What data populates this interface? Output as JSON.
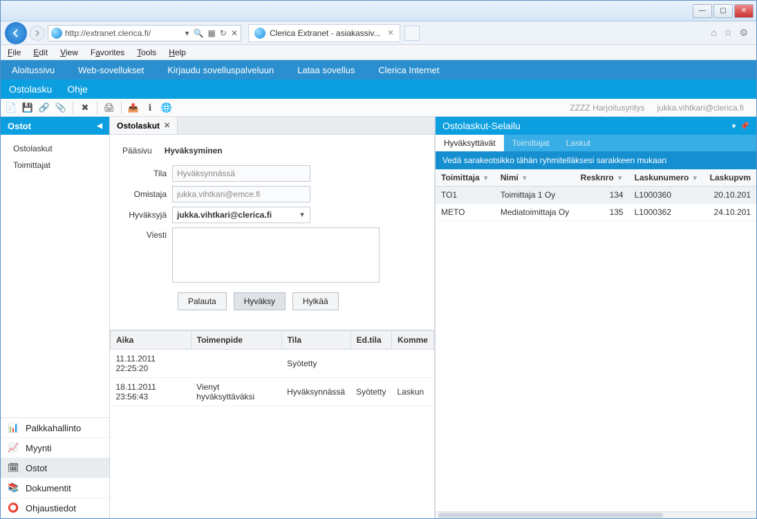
{
  "window": {
    "minimize": "—",
    "maximize": "▢",
    "close": "✕"
  },
  "browser": {
    "url": "http://extranet.clerica.fi/",
    "tab_title": "Clerica Extranet - asiakassiv...",
    "home_icon": "⌂",
    "star_icon": "☆",
    "gear_icon": "⚙"
  },
  "menubar": {
    "file": "File",
    "edit": "Edit",
    "view": "View",
    "favorites": "Favorites",
    "tools": "Tools",
    "help": "Help"
  },
  "appnav1": {
    "aloitussivu": "Aloitussivu",
    "websovellukset": "Web-sovellukset",
    "kirjaudu": "Kirjaudu sovelluspalveluun",
    "lataa": "Lataa sovellus",
    "clerica": "Clerica Internet"
  },
  "appnav2": {
    "ostolasku": "Ostolasku",
    "ohje": "Ohje"
  },
  "userbar": {
    "org": "ZZZZ Harjoitusyritys",
    "email": "jukka.vihtkari@clerica.fi"
  },
  "sidebar": {
    "head": "Ostot",
    "items": [
      "Ostolaskut",
      "Toimittajat"
    ],
    "nav": [
      {
        "label": "Palkkahallinto"
      },
      {
        "label": "Myynti"
      },
      {
        "label": "Ostot"
      },
      {
        "label": "Dokumentit"
      },
      {
        "label": "Ohjaustiedot"
      }
    ]
  },
  "center": {
    "tab_title": "Ostolaskut",
    "form_tabs": {
      "paasivu": "Pääsivu",
      "hyvaksyminen": "Hyväksyminen"
    },
    "labels": {
      "tila": "Tila",
      "omistaja": "Omistaja",
      "hyvaksyja": "Hyväksyjä",
      "viesti": "Viesti"
    },
    "values": {
      "tila": "Hyväksynnässä",
      "omistaja": "jukka.vihtkari@emce.fi",
      "hyvaksyja": "jukka.vihtkari@clerica.fi",
      "viesti": ""
    },
    "buttons": {
      "palauta": "Palauta",
      "hyvaksy": "Hyväksy",
      "hylkaa": "Hylkää"
    },
    "history": {
      "cols": [
        "Aika",
        "Toimenpide",
        "Tila",
        "Ed.tila",
        "Komme"
      ],
      "rows": [
        {
          "aika": "11.11.2011 22:25:20",
          "toimenpide": "",
          "tila": "Syötetty",
          "edtila": "",
          "komme": ""
        },
        {
          "aika": "18.11.2011 23:56:43",
          "toimenpide": "Vienyt hyväksyttäväksi",
          "tila": "Hyväksynnässä",
          "edtila": "Syötetty",
          "komme": "Laskun "
        }
      ]
    }
  },
  "right": {
    "head": "Ostolaskut-Selailu",
    "tabs": {
      "hyvaksyttavat": "Hyväksyttävät",
      "toimittajat": "Toimittajat",
      "laskut": "Laskut"
    },
    "hint": "Vedä sarakeotsikko tähän ryhmitelläksesi sarakkeen mukaan",
    "cols": [
      "Toimittaja",
      "Nimi",
      "Resknro",
      "Laskunumero",
      "Laskupvm"
    ],
    "rows": [
      {
        "toimittaja": "TO1",
        "nimi": "Toimittaja 1 Oy",
        "resknro": "134",
        "laskunumero": "L1000360",
        "laskupvm": "20.10.201"
      },
      {
        "toimittaja": "METO",
        "nimi": "Mediatoimittaja Oy",
        "resknro": "135",
        "laskunumero": "L1000362",
        "laskupvm": "24.10.201"
      }
    ]
  }
}
